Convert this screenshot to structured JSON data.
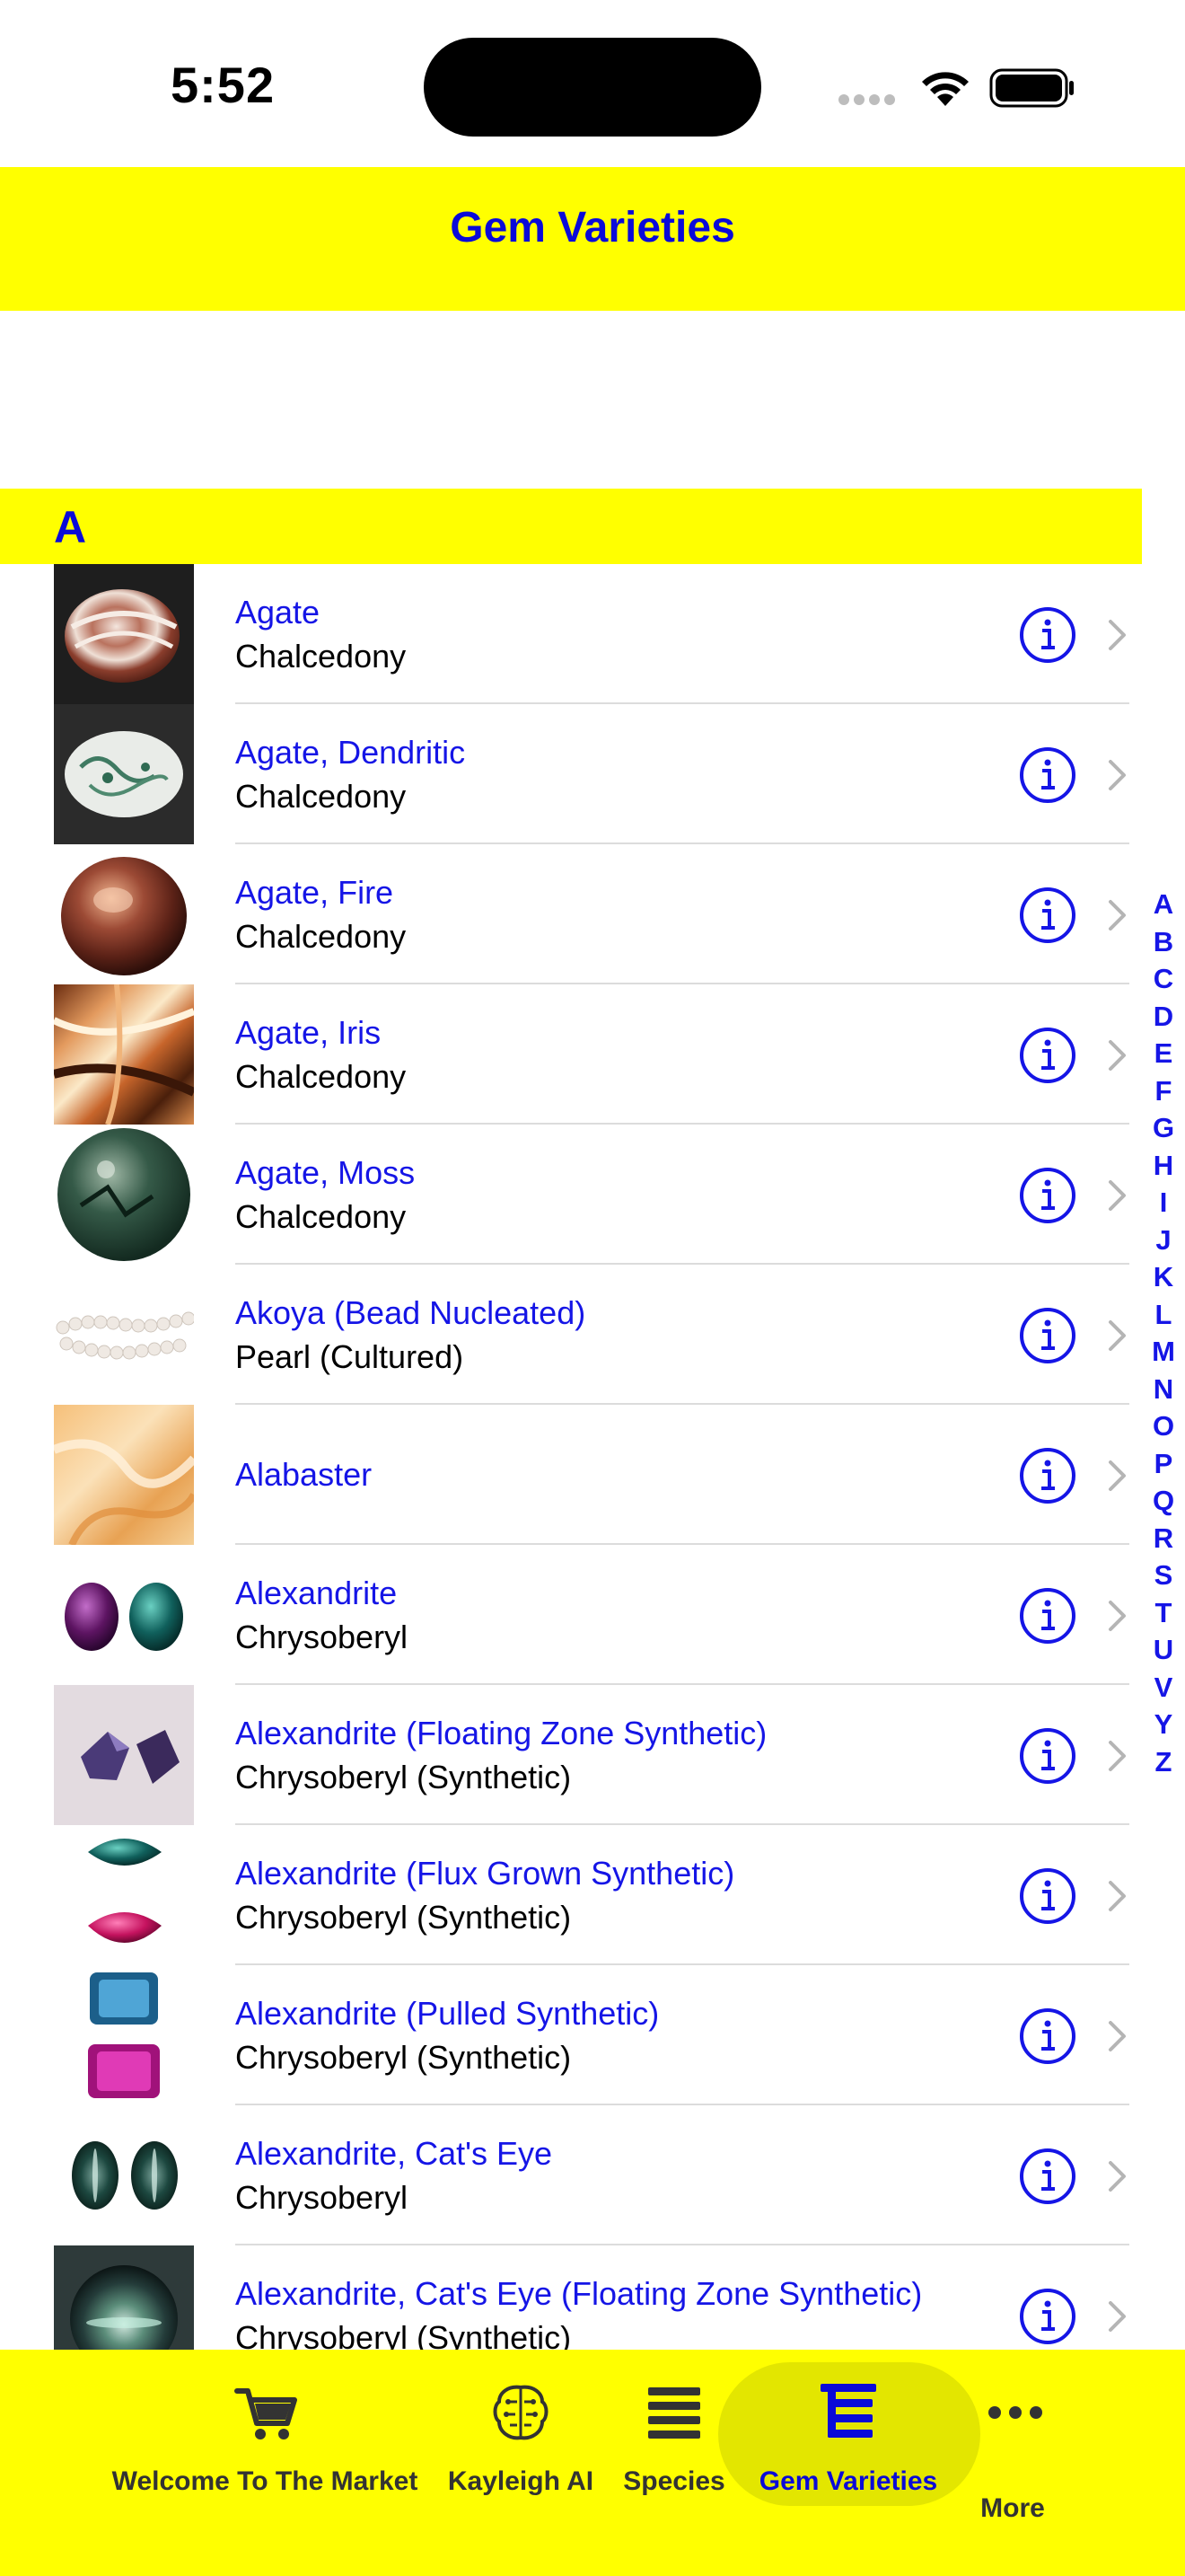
{
  "status_bar": {
    "time": "5:52"
  },
  "header": {
    "title": "Gem Varieties"
  },
  "section": {
    "letter": "A"
  },
  "rows": [
    {
      "title": "Agate",
      "subtitle": "Chalcedony",
      "thumb": "agate-banded-pink"
    },
    {
      "title": "Agate, Dendritic",
      "subtitle": "Chalcedony",
      "thumb": "agate-dendritic"
    },
    {
      "title": "Agate, Fire",
      "subtitle": "Chalcedony",
      "thumb": "agate-fire"
    },
    {
      "title": "Agate, Iris",
      "subtitle": "Chalcedony",
      "thumb": "agate-iris"
    },
    {
      "title": "Agate, Moss",
      "subtitle": "Chalcedony",
      "thumb": "agate-moss"
    },
    {
      "title": "Akoya (Bead Nucleated)",
      "subtitle": "Pearl (Cultured)",
      "thumb": "pearl-strand"
    },
    {
      "title": "Alabaster",
      "subtitle": "",
      "thumb": "alabaster"
    },
    {
      "title": "Alexandrite",
      "subtitle": "Chrysoberyl",
      "thumb": "alexandrite-pair"
    },
    {
      "title": "Alexandrite (Floating Zone Synthetic)",
      "subtitle": "Chrysoberyl (Synthetic)",
      "thumb": "alexandrite-rough"
    },
    {
      "title": "Alexandrite (Flux Grown Synthetic)",
      "subtitle": "Chrysoberyl (Synthetic)",
      "thumb": "alexandrite-flux"
    },
    {
      "title": "Alexandrite (Pulled Synthetic)",
      "subtitle": "Chrysoberyl (Synthetic)",
      "thumb": "alexandrite-pulled"
    },
    {
      "title": "Alexandrite, Cat's Eye",
      "subtitle": "Chrysoberyl",
      "thumb": "cats-eye-pair"
    },
    {
      "title": "Alexandrite, Cat's Eye (Floating Zone Synthetic)",
      "subtitle": "Chrysoberyl (Synthetic)",
      "thumb": "cats-eye-synthetic"
    }
  ],
  "index_letters": [
    "A",
    "B",
    "C",
    "D",
    "E",
    "F",
    "G",
    "H",
    "I",
    "J",
    "K",
    "L",
    "M",
    "N",
    "O",
    "P",
    "Q",
    "R",
    "S",
    "T",
    "U",
    "V",
    "Y",
    "Z"
  ],
  "tabs": [
    {
      "label": "Welcome To The Market",
      "icon": "cart-icon",
      "selected": false
    },
    {
      "label": "Kayleigh AI",
      "icon": "brain-icon",
      "selected": false
    },
    {
      "label": "Species",
      "icon": "list-icon",
      "selected": false
    },
    {
      "label": "Gem Varieties",
      "icon": "indent-list-icon",
      "selected": true
    },
    {
      "label": "More",
      "icon": "ellipsis-icon",
      "selected": false
    }
  ],
  "colors": {
    "accent_yellow": "#ffff00",
    "link_blue": "#1515e6",
    "title_blue": "#0a0ad8"
  }
}
